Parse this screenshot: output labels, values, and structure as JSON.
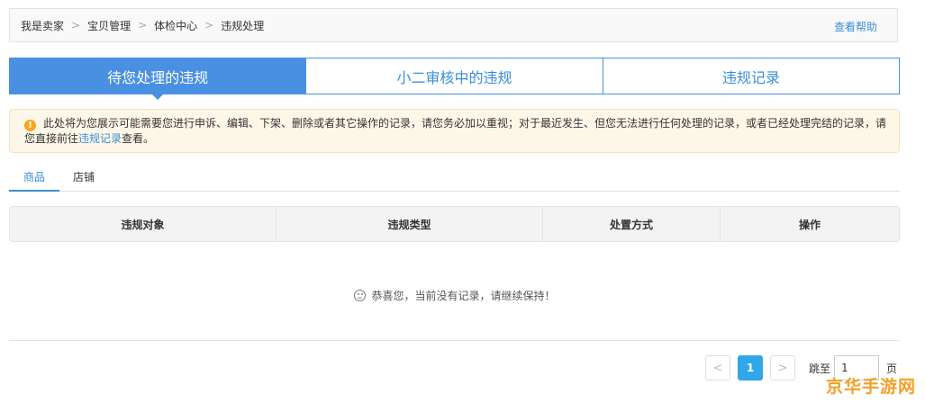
{
  "breadcrumb": {
    "items": [
      "我是卖家",
      "宝贝管理",
      "体检中心",
      "违规处理"
    ],
    "separator": ">"
  },
  "help_link": "查看帮助",
  "main_tabs": [
    {
      "label": "待您处理的违规",
      "active": true
    },
    {
      "label": "小二审核中的违规",
      "active": false
    },
    {
      "label": "违规记录",
      "active": false
    }
  ],
  "notice": {
    "icon": "!",
    "text_before": "此处将为您展示可能需要您进行申诉、编辑、下架、删除或者其它操作的记录，请您务必加以重视；对于最近发生、但您无法进行任何处理的记录，或者已经处理完结的记录，请您直接前往",
    "link": "违规记录",
    "text_after": "查看。"
  },
  "sub_tabs": [
    {
      "label": "商品",
      "active": true
    },
    {
      "label": "店铺",
      "active": false
    }
  ],
  "table": {
    "columns": [
      "违规对象",
      "违规类型",
      "处置方式",
      "操作"
    ]
  },
  "empty_message": "恭喜您，当前没有记录，请继续保持！",
  "pagination": {
    "prev": "<",
    "current_page": "1",
    "next": ">",
    "jump_label": "跳至",
    "jump_value": "1",
    "jump_unit": "页"
  },
  "watermark": "京华手游网",
  "colors": {
    "accent": "#4a90e2",
    "link": "#3a8ed8",
    "notice_bg": "#fdf7e8",
    "warning": "#f5a623",
    "page_active": "#2fa7e8"
  }
}
